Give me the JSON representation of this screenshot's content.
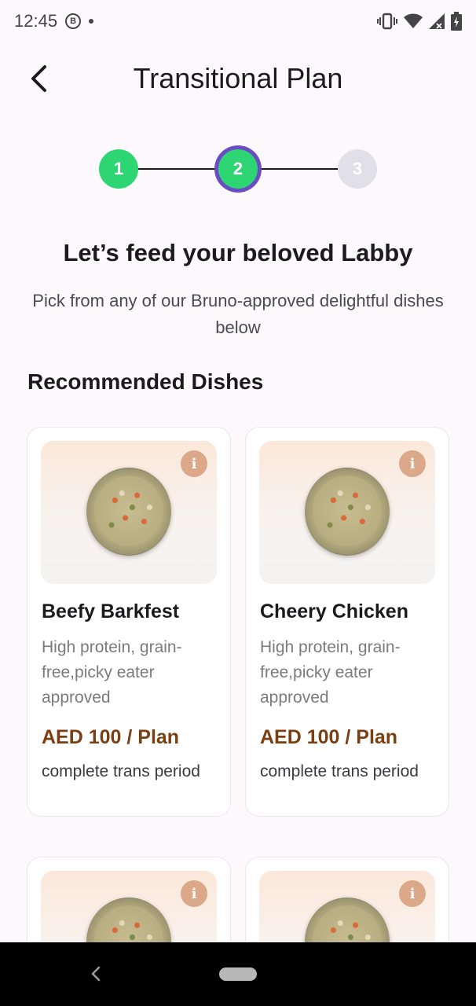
{
  "status_bar": {
    "time": "12:45",
    "icons": [
      "b-badge-icon",
      "dot-icon",
      "vibrate-icon",
      "wifi-icon",
      "signal-icon",
      "battery-charging-icon"
    ]
  },
  "header": {
    "title": "Transitional Plan",
    "back_icon": "chevron-left-icon"
  },
  "stepper": {
    "steps": [
      {
        "label": "1",
        "state": "done"
      },
      {
        "label": "2",
        "state": "active"
      },
      {
        "label": "3",
        "state": "pending"
      }
    ],
    "colors": {
      "done": "#2ed573",
      "active_ring": "#6a4cc4",
      "pending": "#e1e0e6"
    }
  },
  "intro": {
    "title": "Let’s feed your beloved Labby",
    "subtitle": "Pick from any of our Bruno-approved delightful dishes below"
  },
  "section": {
    "title": "Recommended Dishes"
  },
  "dishes": [
    {
      "name": "Beefy Barkfest",
      "description": "High protein, grain-free,picky eater approved",
      "price": "AED 100 / Plan",
      "period": "complete trans period"
    },
    {
      "name": "Cheery Chicken",
      "description": "High protein, grain-free,picky eater approved",
      "price": "AED 100 / Plan",
      "period": "complete trans period"
    },
    {
      "name": "",
      "description": "",
      "price": "",
      "period": ""
    },
    {
      "name": "",
      "description": "",
      "price": "",
      "period": ""
    }
  ],
  "colors": {
    "price": "#7a3f12",
    "info_badge": "#dba98a"
  },
  "nav_bar": {
    "icons": [
      "back-triangle-icon",
      "home-pill-icon"
    ]
  }
}
